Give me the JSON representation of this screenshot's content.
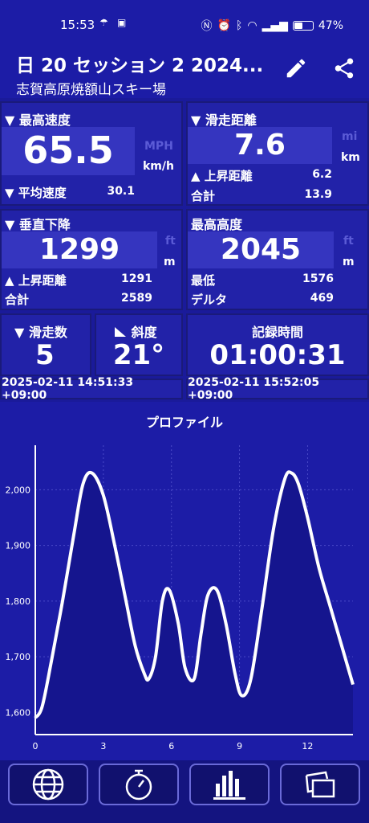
{
  "status": {
    "time": "15:53",
    "battery": "47%",
    "battery_fraction": 0.47
  },
  "header": {
    "title": "日 20 セッション 2 2024...",
    "subtitle": "志賀高原焼額山スキー場"
  },
  "speed": {
    "label": "▼ 最高速度",
    "max": "65.5",
    "unit_inactive": "MPH",
    "unit_active": "km/h",
    "avg_label": "▼ 平均速度",
    "avg": "30.1"
  },
  "distance": {
    "label": "▼ 滑走距離",
    "value": "7.6",
    "unit_inactive": "mi",
    "unit_active": "km",
    "ascent_label": "▲ 上昇距離",
    "ascent": "6.2",
    "total_label": "合計",
    "total": "13.9"
  },
  "descent": {
    "label": "▼ 垂直下降",
    "value": "1299",
    "unit_inactive": "ft",
    "unit_active": "m",
    "ascent_label": "▲ 上昇距離",
    "ascent": "1291",
    "total_label": "合計",
    "total": "2589"
  },
  "altitude": {
    "label": "最高高度",
    "value": "2045",
    "unit_inactive": "ft",
    "unit_active": "m",
    "min_label": "最低",
    "min": "1576",
    "delta_label": "デルタ",
    "delta": "469"
  },
  "runs": {
    "label": "▼ 滑走数",
    "value": "5"
  },
  "slope": {
    "label": "斜度",
    "value": "21°"
  },
  "duration": {
    "label": "記録時間",
    "value": "01:00:31"
  },
  "timestamps": {
    "start": "2025-02-11 14:51:33 +09:00",
    "end": "2025-02-11 15:52:05 +09:00"
  },
  "chart_data": {
    "type": "line",
    "title": "プロファイル",
    "xlabel": "",
    "ylabel": "",
    "xlim": [
      0,
      14
    ],
    "ylim": [
      1560,
      2080
    ],
    "xticks": [
      0,
      3,
      6,
      9,
      12
    ],
    "yticks": [
      1600,
      1700,
      1800,
      1900,
      2000
    ],
    "ytick_labels": [
      "1,600",
      "1,700",
      "1,800",
      "1,900",
      "2,000"
    ],
    "grid": true,
    "series": [
      {
        "x": [
          0,
          0.3,
          0.7,
          1.2,
          1.7,
          2.1,
          2.5,
          3.0,
          3.5,
          4.0,
          4.4,
          4.8,
          5.0,
          5.3,
          5.6,
          5.9,
          6.3,
          6.6,
          7.0,
          7.3,
          7.6,
          8.0,
          8.4,
          8.8,
          9.1,
          9.5,
          10.0,
          10.5,
          11.0,
          11.3,
          11.6,
          12.0,
          12.5,
          13.0,
          13.5,
          14.0
        ],
        "y": [
          1590,
          1610,
          1690,
          1800,
          1920,
          2010,
          2030,
          1990,
          1900,
          1800,
          1720,
          1670,
          1660,
          1700,
          1800,
          1820,
          1760,
          1680,
          1660,
          1740,
          1810,
          1820,
          1760,
          1670,
          1630,
          1660,
          1790,
          1930,
          2020,
          2030,
          2010,
          1950,
          1860,
          1790,
          1720,
          1650
        ]
      }
    ]
  },
  "nav": {
    "items": [
      {
        "icon": "globe-icon"
      },
      {
        "icon": "stopwatch-icon"
      },
      {
        "icon": "bar-chart-icon"
      },
      {
        "icon": "photos-icon"
      }
    ]
  },
  "colors": {
    "background": "#1a1a9a",
    "panel": "#2222a8",
    "value_box": "#3535bf",
    "line": "#ffffff"
  }
}
